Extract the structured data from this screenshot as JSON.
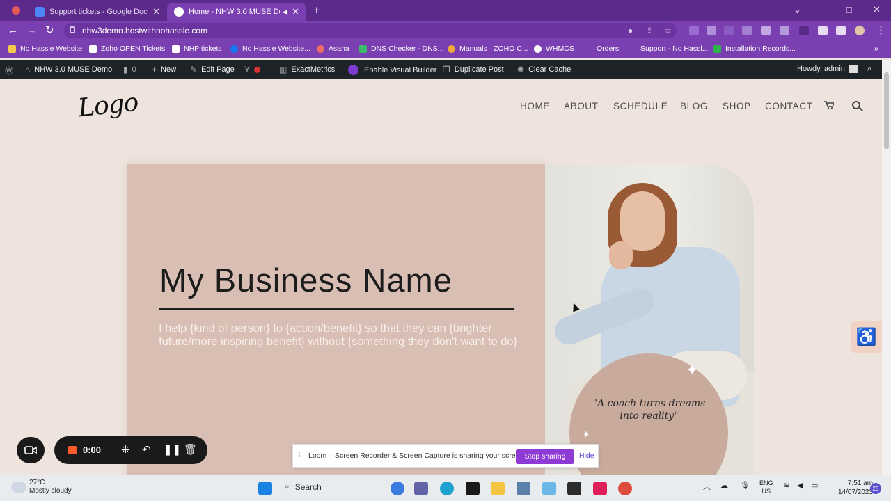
{
  "browser": {
    "tabs": [
      {
        "title": "Support tickets - Google Docs",
        "active": false
      },
      {
        "title": "Home - NHW 3.0 MUSE Der",
        "active": true
      }
    ],
    "new_tab": "+",
    "url": "nhw3demo.hostwithnohassle.com",
    "bookmarks": [
      "No Hassle Website",
      "Zoho OPEN Tickets",
      "NHP tickets",
      "No Hassle Website...",
      "Asana",
      "DNS Checker - DNS...",
      "Manuals · ZOHO C...",
      "WHMCS",
      "Orders",
      "Support - No Hassl...",
      "Installation Records..."
    ]
  },
  "wp_admin": {
    "site": "NHW 3.0 MUSE Demo",
    "comments": "0",
    "new": "New",
    "edit": "Edit Page",
    "exactmetrics": "ExactMetrics",
    "visual_builder": "Enable Visual Builder",
    "duplicate": "Duplicate Post",
    "cache": "Clear Cache",
    "howdy": "Howdy, admin"
  },
  "site": {
    "logo": "Logo",
    "nav": [
      "HOME",
      "ABOUT",
      "SCHEDULE",
      "BLOG",
      "SHOP",
      "CONTACT"
    ],
    "hero_title": "My Business Name",
    "hero_sub": "I help {kind of person} to {action/benefit} so that they can {brighter future/more inspiring benefit} without {something they don't want to do}",
    "quote": "\"A coach turns dreams into reality\""
  },
  "loom": {
    "time": "0:00",
    "notice": "Loom – Screen Recorder & Screen Capture is sharing your screen.",
    "stop": "Stop sharing",
    "hide": "Hide"
  },
  "taskbar": {
    "temp": "27°C",
    "weather": "Mostly cloudy",
    "search": "Search",
    "lang1": "ENG",
    "lang2": "US",
    "time": "7:51 am",
    "date": "14/07/2023",
    "badge": "23"
  },
  "colors": {
    "chrome_purple": "#7a3fb0",
    "hero_pink": "#d9beb4",
    "page_bg": "#efe3dd",
    "loom_purple": "#8e3ad4"
  }
}
